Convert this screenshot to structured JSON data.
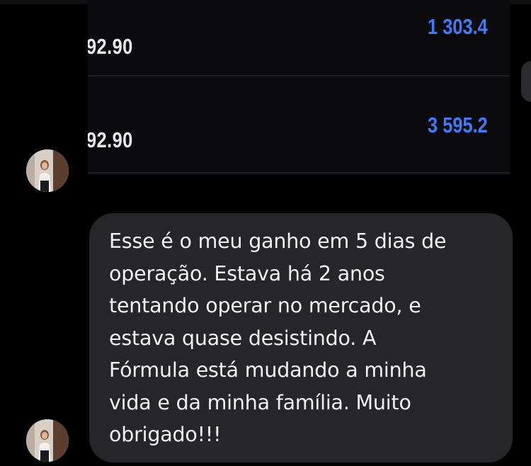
{
  "trades": [
    {
      "price": "92.90",
      "profit": "1 303.4"
    },
    {
      "price": "92.90",
      "profit": "3 595.2"
    }
  ],
  "message": {
    "text": "Esse é o meu ganho em 5 dias de\noperação. Estava há 2 anos\ntentando operar no mercado, e\nestava quase desistindo. A\nFórmula está mudando a minha\nvida e da minha família. Muito\nobrigado!!!"
  },
  "colors": {
    "background": "#000000",
    "bubble": "#262628",
    "profit": "#3d7bff",
    "price": "#e8e8ea"
  },
  "icons": {
    "avatar": "user-avatar-photo"
  }
}
